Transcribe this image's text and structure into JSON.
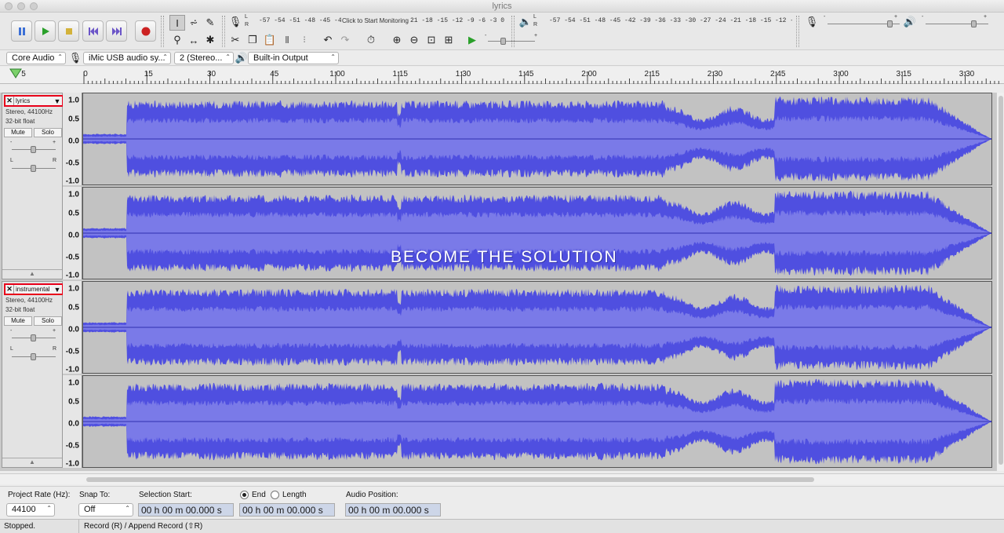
{
  "window": {
    "title": "lyrics"
  },
  "transport": {
    "pause": "pause-icon",
    "play": "play-icon",
    "stop": "stop-icon",
    "skip_start": "skip-to-start-icon",
    "skip_end": "skip-to-end-icon",
    "record": "record-icon"
  },
  "meters": {
    "record_channels": [
      "L",
      "R"
    ],
    "record_scale_left": "-57 -54 -51 -48 -45 -42 -3",
    "record_prompt": "Click to Start Monitoring",
    "record_scale_right": "21 -18 -15 -12 -9 -6 -3 0",
    "playback_channels": [
      "L",
      "R"
    ],
    "playback_scale": "-57 -54 -51 -48 -45 -42 -39 -36 -33 -30 -27 -24 -21 -18 -15 -12 -9 -6 -3 0"
  },
  "mixer": {
    "minus": "-",
    "plus": "+"
  },
  "devices": {
    "host": "Core Audio",
    "input": "iMic USB audio sy...",
    "channels": "2 (Stereo...",
    "output": "Built-in Output"
  },
  "ruler": {
    "labels": [
      "5",
      "0",
      "15",
      "30",
      "45",
      "1:00",
      "1:15",
      "1:30",
      "1:45",
      "2:00",
      "2:15",
      "2:30",
      "2:45",
      "3:00",
      "3:15",
      "3:30"
    ]
  },
  "vscale": [
    "1.0",
    "0.5",
    "0.0",
    "-0.5",
    "-1.0"
  ],
  "tracks": [
    {
      "name": "lyrics",
      "format": "Stereo, 44100Hz",
      "depth": "32-bit float",
      "mute": "Mute",
      "solo": "Solo",
      "gain_minus": "-",
      "gain_plus": "+",
      "pan_l": "L",
      "pan_r": "R",
      "collapse": "▲"
    },
    {
      "name": "instrumental",
      "format": "Stereo, 44100Hz",
      "depth": "32-bit float",
      "mute": "Mute",
      "solo": "Solo",
      "gain_minus": "-",
      "gain_plus": "+",
      "pan_l": "L",
      "pan_r": "R",
      "collapse": "▲"
    }
  ],
  "watermark": "BECOME THE SOLUTION",
  "selection": {
    "rate_label": "Project Rate (Hz):",
    "rate_value": "44100",
    "snap_label": "Snap To:",
    "snap_value": "Off",
    "start_label": "Selection Start:",
    "end_label": "End",
    "length_label": "Length",
    "position_label": "Audio Position:",
    "end_selected": true,
    "start_time": "00 h 00 m 00.000 s",
    "end_time": "00 h 00 m 00.000 s",
    "position_time": "00 h 00 m 00.000 s"
  },
  "status": {
    "left": "Stopped.",
    "right": "Record (R) / Append Record (⇧R)"
  },
  "colors": {
    "waveform": "#4f4fe0",
    "waveform_rms": "#7a7ae8",
    "highlight_border": "#e8001a"
  }
}
